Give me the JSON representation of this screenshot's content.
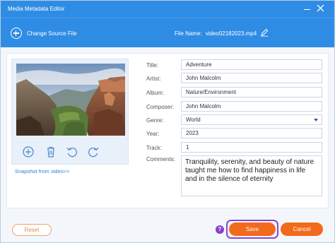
{
  "window": {
    "title": "Media Metadata Editor"
  },
  "toolbar": {
    "change_source_label": "Change Source File",
    "file_name_label": "File Name:",
    "file_name_value": "video02182023.mp4"
  },
  "thumbnail": {
    "snapshot_link": "Snapshot from video>>"
  },
  "fields": {
    "title": {
      "label": "Title:",
      "value": "Adventure"
    },
    "artist": {
      "label": "Artist:",
      "value": "John Malcolm"
    },
    "album": {
      "label": "Album:",
      "value": "Nature/Environment"
    },
    "composer": {
      "label": "Composer:",
      "value": "John Malcolm"
    },
    "genre": {
      "label": "Genre:",
      "value": "World"
    },
    "year": {
      "label": "Year:",
      "value": "2023"
    },
    "track": {
      "label": "Track:",
      "value": "1"
    },
    "comments": {
      "label": "Comments:",
      "value": "Tranquility, serenity, and beauty of nature taught me how to find happiness in life and in the silence of eternity"
    }
  },
  "footer": {
    "reset_label": "Reset",
    "help_symbol": "?",
    "save_label": "Save",
    "cancel_label": "Cancel"
  },
  "colors": {
    "header_blue": "#2f8ce4",
    "button_orange": "#f26a1b",
    "focus_purple": "#8e44cf"
  }
}
